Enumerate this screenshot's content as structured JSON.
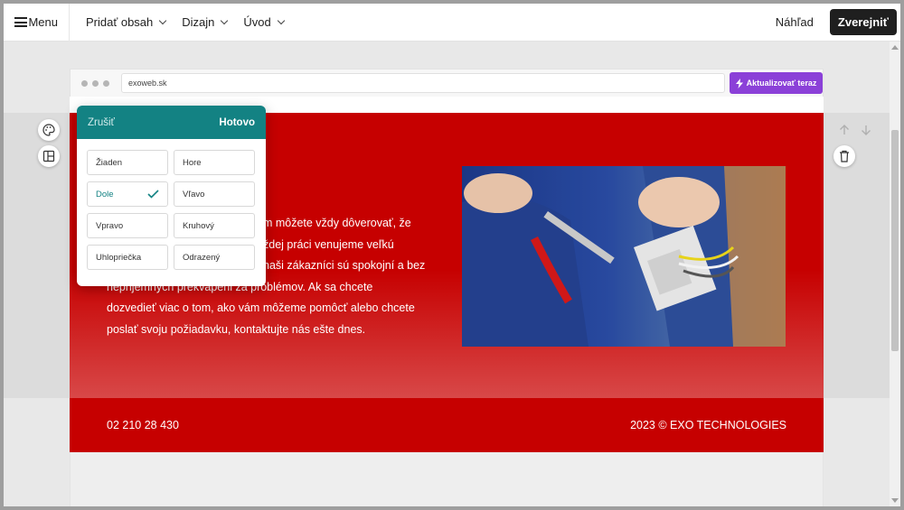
{
  "topbar": {
    "menu_label": "Menu",
    "nav": [
      "Pridať obsah",
      "Dizajn",
      "Úvod"
    ],
    "preview_label": "Náhľad",
    "publish_label": "Zverejniť"
  },
  "browser": {
    "url": "exoweb.sk",
    "update_label": "Aktualizovať teraz",
    "accent": "#8b40d8"
  },
  "popup": {
    "cancel_label": "Zrušiť",
    "done_label": "Hotovo",
    "header_color": "#138283",
    "options": [
      "Žiaden",
      "Hore",
      "Dole",
      "Vľavo",
      "Vpravo",
      "Kruhový",
      "Uhlopriečka",
      "Odrazený"
    ],
    "selected": "Dole"
  },
  "hero": {
    "lines": [
      "ám môžete vždy dôverovať, že",
      "ždej práci venujeme veľkú",
      "naši zákazníci sú spokojní a bez",
      "neprijemnych prekvapeni za problémov. Ak sa chcete",
      "dozvedieť viac o tom, ako vám môžeme pomôcť alebo chcete",
      "poslať svoju požiadavku, kontaktujte nás ešte dnes."
    ],
    "brand_color": "#c60000"
  },
  "footer": {
    "phone": "02 210 28 430",
    "copyright": "2023 © EXO TECHNOLOGIES"
  }
}
